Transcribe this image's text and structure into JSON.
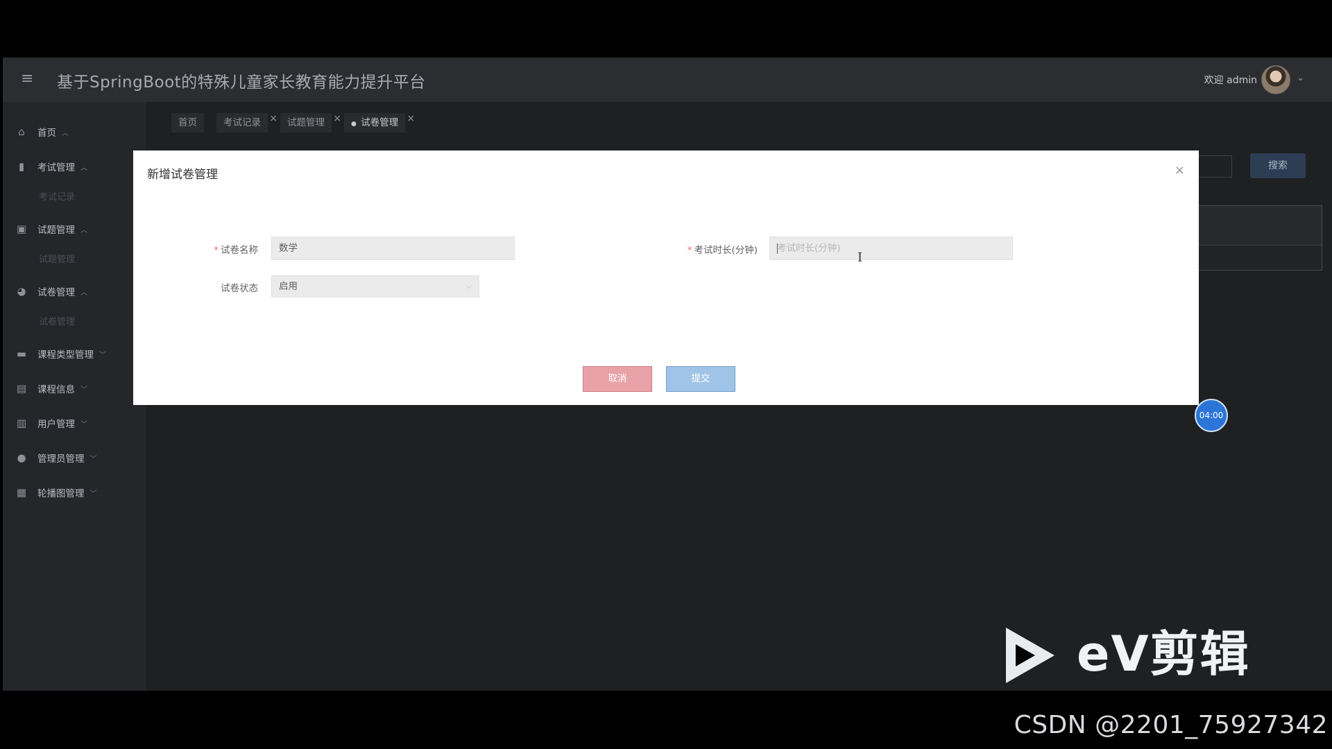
{
  "header": {
    "title": "基于SpringBoot的特殊儿童家长教育能力提升平台",
    "welcome": "欢迎 admin"
  },
  "sidebar": {
    "items": [
      {
        "label": "首页",
        "icon": "home-icon"
      },
      {
        "label": "考试管理",
        "icon": "book-icon"
      },
      {
        "label": "试题管理",
        "icon": "clipboard-icon"
      },
      {
        "label": "试卷管理",
        "icon": "gauge-icon"
      },
      {
        "label": "课程类型管理",
        "icon": "briefcase-icon"
      },
      {
        "label": "课程信息",
        "icon": "notebook-icon"
      },
      {
        "label": "用户管理",
        "icon": "columns-icon"
      },
      {
        "label": "管理员管理",
        "icon": "circle-icon"
      },
      {
        "label": "轮播图管理",
        "icon": "grid-icon"
      }
    ],
    "subitems": {
      "exam": "考试记录",
      "question": "试题管理",
      "paper": "试卷管理"
    }
  },
  "tabs": [
    {
      "label": "首页",
      "closable": false
    },
    {
      "label": "考试记录",
      "closable": true
    },
    {
      "label": "试题管理",
      "closable": true
    },
    {
      "label": "试卷管理",
      "closable": true,
      "active": true
    }
  ],
  "background": {
    "search_button": "搜索"
  },
  "modal": {
    "title": "新增试卷管理",
    "fields": {
      "paper_name_label": "试卷名称",
      "paper_name_value": "数学",
      "duration_label": "考试时长(分钟)",
      "duration_placeholder": "考试时长(分钟)",
      "status_label": "试卷状态",
      "status_value": "启用"
    },
    "cancel_label": "取消",
    "submit_label": "提交"
  },
  "timer": "04:00",
  "overlay": {
    "ev_text": "eV剪辑",
    "watermark": "CSDN @2201_75927342"
  },
  "colors": {
    "cancel": "#e8a2a8",
    "submit": "#9fc4e7",
    "required": "#f56c6c",
    "timer": "#2b74d8"
  }
}
